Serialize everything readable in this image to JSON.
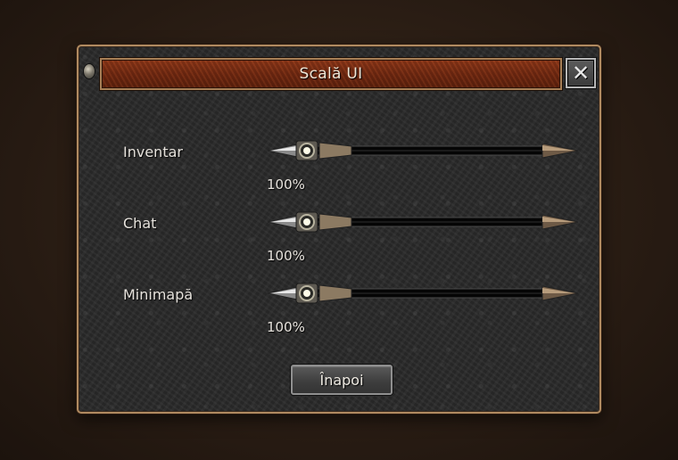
{
  "window": {
    "title": "Scală UI",
    "close_label": "✕",
    "back_label": "Înapoi"
  },
  "settings": [
    {
      "label": "Inventar",
      "value_text": "100%",
      "value_fraction": 0.0
    },
    {
      "label": "Chat",
      "value_text": "100%",
      "value_fraction": 0.0
    },
    {
      "label": "Minimapă",
      "value_text": "100%",
      "value_fraction": 0.0
    }
  ],
  "colors": {
    "title_bar": "#6d2710",
    "frame": "#b08a60",
    "text": "#e6e2dc"
  }
}
